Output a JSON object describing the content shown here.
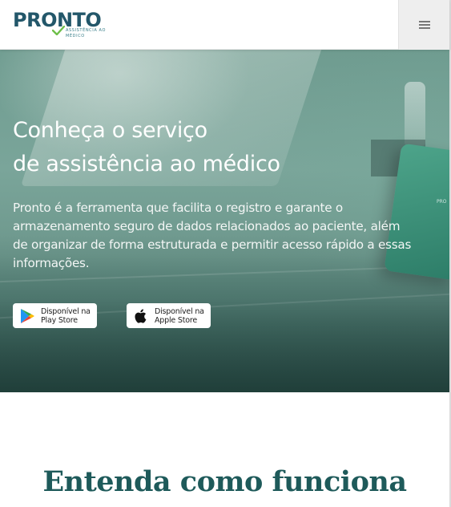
{
  "header": {
    "logo_word": "PRONTO",
    "logo_sub": "ASSISTÊNCIA AO MÉDICO",
    "menu_icon": "hamburger-menu-icon"
  },
  "hero": {
    "title_line1": "Conheça o serviço",
    "title_line2": "de assistência ao médico",
    "description": "Pronto é a ferramenta que facilita o registro e garante o armazenamento seguro de dados relacionados ao paciente, além de organizar de forma estruturada e permitir acesso rápido a essas informações.",
    "phone_text": "PRO",
    "play_store": {
      "line1": "Disponível na",
      "line2": "Play Store",
      "icon": "google-play-icon"
    },
    "apple_store": {
      "line1": "Disponível na",
      "line2": "Apple Store",
      "icon": "apple-icon"
    }
  },
  "section": {
    "title": "Entenda como funciona"
  },
  "colors": {
    "brand_dark": "#23576a",
    "brand_green": "#6fbf4a",
    "section_title": "#1e5a5a",
    "hero_overlay": "#6f9c90"
  }
}
